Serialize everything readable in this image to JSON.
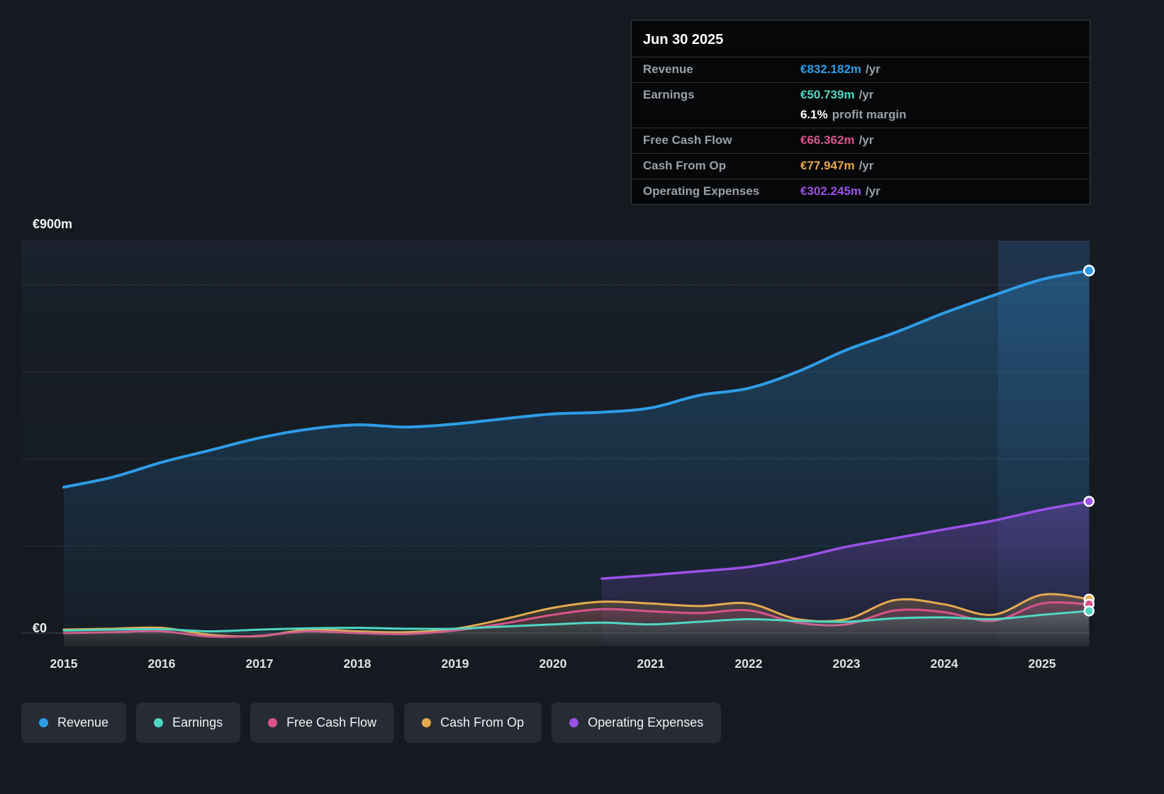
{
  "colors": {
    "background": "#151a21",
    "revenue": "#2e9de8",
    "earnings": "#4fd6c2",
    "free_cash_flow": "#d9538c",
    "cash_from_op": "#e5aa4e",
    "operating_expenses": "#9b51e8"
  },
  "tooltip": {
    "date": "Jun 30 2025",
    "rows": [
      {
        "label": "Revenue",
        "value": "€832.182m",
        "suffix": "/yr",
        "color": "#2e9de8",
        "sub": false
      },
      {
        "label": "Earnings",
        "value": "€50.739m",
        "suffix": "/yr",
        "color": "#4fd6c2",
        "sub": false
      },
      {
        "label": "",
        "value": "6.1%",
        "suffix": "profit margin",
        "color": "#ffffff",
        "sub": true
      },
      {
        "label": "Free Cash Flow",
        "value": "€66.362m",
        "suffix": "/yr",
        "color": "#d9538c",
        "sub": false
      },
      {
        "label": "Cash From Op",
        "value": "€77.947m",
        "suffix": "/yr",
        "color": "#e5aa4e",
        "sub": false
      },
      {
        "label": "Operating Expenses",
        "value": "€302.245m",
        "suffix": "/yr",
        "color": "#9b51e8",
        "sub": false
      }
    ]
  },
  "chart_data": {
    "type": "area",
    "title": "",
    "xlabel": "",
    "ylabel": "",
    "y_label_top": "€900m",
    "y_label_zero": "€0",
    "ylim": [
      0,
      900
    ],
    "x_range": [
      2015,
      2025.48
    ],
    "gridlines": [
      0,
      200,
      400,
      600,
      800,
      900
    ],
    "grid_on": true,
    "legend_position": "bottom-left",
    "highlight_from": 2024.55,
    "x_ticks": [
      2015,
      2016,
      2017,
      2018,
      2019,
      2020,
      2021,
      2022,
      2023,
      2024,
      2025
    ],
    "series": [
      {
        "key": "revenue",
        "name": "Revenue",
        "color": "#2e9de8",
        "width": 4,
        "fill_top": 0.3,
        "points": [
          [
            2015,
            335
          ],
          [
            2015.5,
            358
          ],
          [
            2016,
            392
          ],
          [
            2016.5,
            420
          ],
          [
            2017,
            448
          ],
          [
            2017.5,
            468
          ],
          [
            2018,
            478
          ],
          [
            2018.5,
            473
          ],
          [
            2019,
            480
          ],
          [
            2019.5,
            492
          ],
          [
            2020,
            503
          ],
          [
            2020.5,
            507
          ],
          [
            2021,
            517
          ],
          [
            2021.5,
            546
          ],
          [
            2022,
            562
          ],
          [
            2022.5,
            600
          ],
          [
            2023,
            650
          ],
          [
            2023.5,
            690
          ],
          [
            2024,
            735
          ],
          [
            2024.5,
            775
          ],
          [
            2025,
            812
          ],
          [
            2025.48,
            832.182
          ]
        ]
      },
      {
        "key": "opex",
        "name": "Operating Expenses",
        "color": "#9b51e8",
        "width": 3.5,
        "fill_top": 0.32,
        "points": [
          [
            2020.5,
            125
          ],
          [
            2021,
            133
          ],
          [
            2021.5,
            142
          ],
          [
            2022,
            152
          ],
          [
            2022.5,
            172
          ],
          [
            2023,
            198
          ],
          [
            2023.5,
            218
          ],
          [
            2024,
            238
          ],
          [
            2024.5,
            258
          ],
          [
            2025,
            283
          ],
          [
            2025.48,
            302.245
          ]
        ]
      },
      {
        "key": "cashop",
        "name": "Cash From Op",
        "color": "#e5aa4e",
        "width": 3,
        "fill_top": 0.25,
        "points": [
          [
            2015,
            8
          ],
          [
            2015.5,
            10
          ],
          [
            2016,
            12
          ],
          [
            2016.5,
            -4
          ],
          [
            2017,
            -7
          ],
          [
            2017.5,
            8
          ],
          [
            2018,
            4
          ],
          [
            2018.5,
            2
          ],
          [
            2019,
            10
          ],
          [
            2019.5,
            32
          ],
          [
            2020,
            58
          ],
          [
            2020.5,
            72
          ],
          [
            2021,
            68
          ],
          [
            2021.5,
            62
          ],
          [
            2022,
            68
          ],
          [
            2022.5,
            32
          ],
          [
            2023,
            32
          ],
          [
            2023.5,
            76
          ],
          [
            2024,
            66
          ],
          [
            2024.5,
            42
          ],
          [
            2025,
            88
          ],
          [
            2025.48,
            77.947
          ]
        ]
      },
      {
        "key": "fcf",
        "name": "Free Cash Flow",
        "color": "#d9538c",
        "width": 3,
        "fill_top": 0.2,
        "points": [
          [
            2015,
            0
          ],
          [
            2015.5,
            2
          ],
          [
            2016,
            4
          ],
          [
            2016.5,
            -8
          ],
          [
            2017,
            -6
          ],
          [
            2017.5,
            4
          ],
          [
            2018,
            0
          ],
          [
            2018.5,
            -2
          ],
          [
            2019,
            6
          ],
          [
            2019.5,
            22
          ],
          [
            2020,
            42
          ],
          [
            2020.5,
            55
          ],
          [
            2021,
            50
          ],
          [
            2021.5,
            46
          ],
          [
            2022,
            52
          ],
          [
            2022.5,
            24
          ],
          [
            2023,
            20
          ],
          [
            2023.5,
            52
          ],
          [
            2024,
            48
          ],
          [
            2024.5,
            28
          ],
          [
            2025,
            68
          ],
          [
            2025.48,
            66.362
          ]
        ]
      },
      {
        "key": "earnings",
        "name": "Earnings",
        "color": "#4fd6c2",
        "width": 3,
        "fill_top": 0.18,
        "points": [
          [
            2015,
            6
          ],
          [
            2015.5,
            8
          ],
          [
            2016,
            9
          ],
          [
            2016.5,
            4
          ],
          [
            2017,
            8
          ],
          [
            2017.5,
            11
          ],
          [
            2018,
            12
          ],
          [
            2018.5,
            10
          ],
          [
            2019,
            10
          ],
          [
            2019.5,
            15
          ],
          [
            2020,
            20
          ],
          [
            2020.5,
            24
          ],
          [
            2021,
            20
          ],
          [
            2021.5,
            26
          ],
          [
            2022,
            32
          ],
          [
            2022.5,
            28
          ],
          [
            2023,
            26
          ],
          [
            2023.5,
            34
          ],
          [
            2024,
            36
          ],
          [
            2024.5,
            32
          ],
          [
            2025,
            42
          ],
          [
            2025.48,
            50.739
          ]
        ]
      }
    ]
  },
  "legend": [
    {
      "key": "revenue",
      "label": "Revenue",
      "color": "#2e9de8"
    },
    {
      "key": "earnings",
      "label": "Earnings",
      "color": "#4fd6c2"
    },
    {
      "key": "fcf",
      "label": "Free Cash Flow",
      "color": "#d9538c"
    },
    {
      "key": "cashop",
      "label": "Cash From Op",
      "color": "#e5aa4e"
    },
    {
      "key": "opex",
      "label": "Operating Expenses",
      "color": "#9b51e8"
    }
  ]
}
